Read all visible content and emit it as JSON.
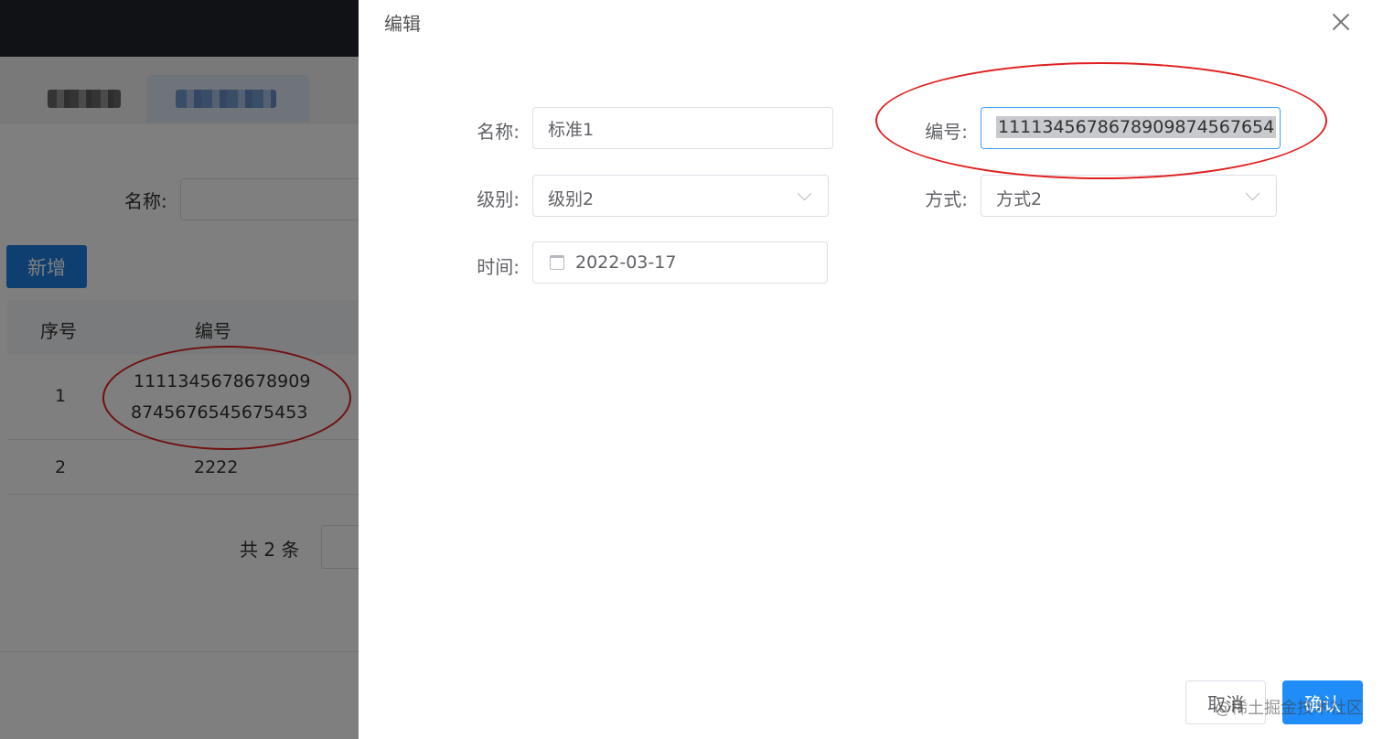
{
  "background": {
    "search": {
      "label": "名称:"
    },
    "add_button": "新增",
    "table": {
      "headers": [
        "序号",
        "编号"
      ],
      "rows": [
        {
          "index": "1",
          "code_line1": "1111345678678909",
          "code_line2": "8745676545675453"
        },
        {
          "index": "2",
          "code_line1": "2222"
        }
      ]
    },
    "pagination": {
      "total": "共 2 条"
    }
  },
  "drawer": {
    "title": "编辑",
    "fields": {
      "name": {
        "label": "名称:",
        "value": "标准1"
      },
      "code": {
        "label": "编号:",
        "value": "1111345678678909874567654"
      },
      "level": {
        "label": "级别:",
        "value": "级别2"
      },
      "method": {
        "label": "方式:",
        "value": "方式2"
      },
      "time": {
        "label": "时间:",
        "value": "2022-03-17"
      }
    },
    "buttons": {
      "cancel": "取消",
      "confirm": "确认"
    }
  },
  "watermark": "@稀土掘金技术社区",
  "colors": {
    "primary": "#1f8cf8",
    "annotation": "#e02020",
    "topbar": "#20242c"
  }
}
